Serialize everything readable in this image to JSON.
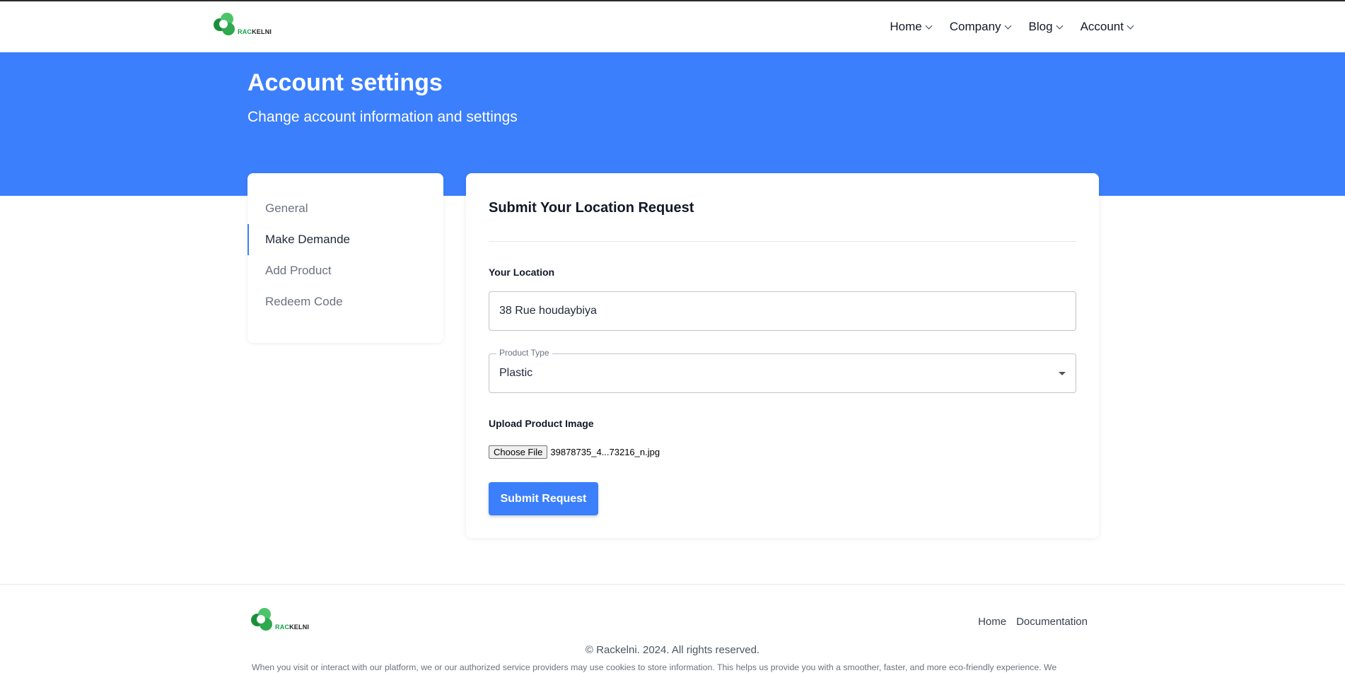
{
  "brand": {
    "logo_text_accent": "RAC",
    "logo_text": "KELNI",
    "logo_colors": {
      "dark_green": "#1a8f3a",
      "light_green": "#4cc46a"
    }
  },
  "nav": {
    "items": [
      {
        "label": "Home"
      },
      {
        "label": "Company"
      },
      {
        "label": "Blog"
      },
      {
        "label": "Account"
      }
    ]
  },
  "hero": {
    "title": "Account settings",
    "subtitle": "Change account information and settings",
    "background": "#3b7ffc"
  },
  "sidebar": {
    "items": [
      {
        "label": "General",
        "active": false
      },
      {
        "label": "Make Demande",
        "active": true
      },
      {
        "label": "Add Product",
        "active": false
      },
      {
        "label": "Redeem Code",
        "active": false
      }
    ]
  },
  "form": {
    "title": "Submit Your Location Request",
    "location_label": "Your Location",
    "location_value": "38 Rue houdaybiya",
    "product_type_label": "Product Type",
    "product_type_value": "Plastic",
    "upload_label": "Upload Product Image",
    "file_button_label": "Choose File",
    "file_name": "39878735_4...73216_n.jpg",
    "submit_label": "Submit Request"
  },
  "footer": {
    "links": [
      {
        "label": "Home"
      },
      {
        "label": "Documentation"
      }
    ],
    "copyright": "© Rackelni. 2024. All rights reserved.",
    "cookie_notice": "When you visit or interact with our platform, we or our authorized service providers may use cookies to store information. This helps us provide you with a smoother, faster, and more eco-friendly experience. We"
  },
  "accent_color": "#3b7ffc"
}
